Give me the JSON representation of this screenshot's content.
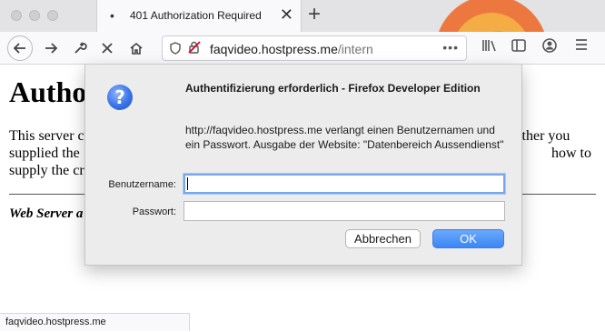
{
  "browser": {
    "tab": {
      "title": "401 Authorization Required",
      "loading_indicator": "•",
      "close_glyph": "✕"
    },
    "new_tab_glyph": "+",
    "url": {
      "host": "faqvideo.hostpress.me",
      "path": "/intern"
    },
    "page_actions_glyph": "•••",
    "status_text": "faqvideo.hostpress.me"
  },
  "page": {
    "heading": "Authorization Required",
    "line1_left": "This server c",
    "line1_right": "either you",
    "line2_left": "supplied the",
    "line2_right": "how to",
    "line3_left": "supply the cr",
    "address_left": "Web Server a"
  },
  "dialog": {
    "title": "Authentifizierung erforderlich - Firefox Developer Edition",
    "message": "http://faqvideo.hostpress.me verlangt einen Benutzernamen und ein Passwort. Ausgabe der Website: \"Datenbereich Aussendienst\"",
    "username_label": "Benutzername:",
    "password_label": "Passwort:",
    "username_value": "",
    "password_value": "",
    "cancel_label": "Abbrechen",
    "ok_label": "OK",
    "icon": "question-icon"
  },
  "colors": {
    "accent": "#3c86f5",
    "insecure": "#d70022"
  }
}
